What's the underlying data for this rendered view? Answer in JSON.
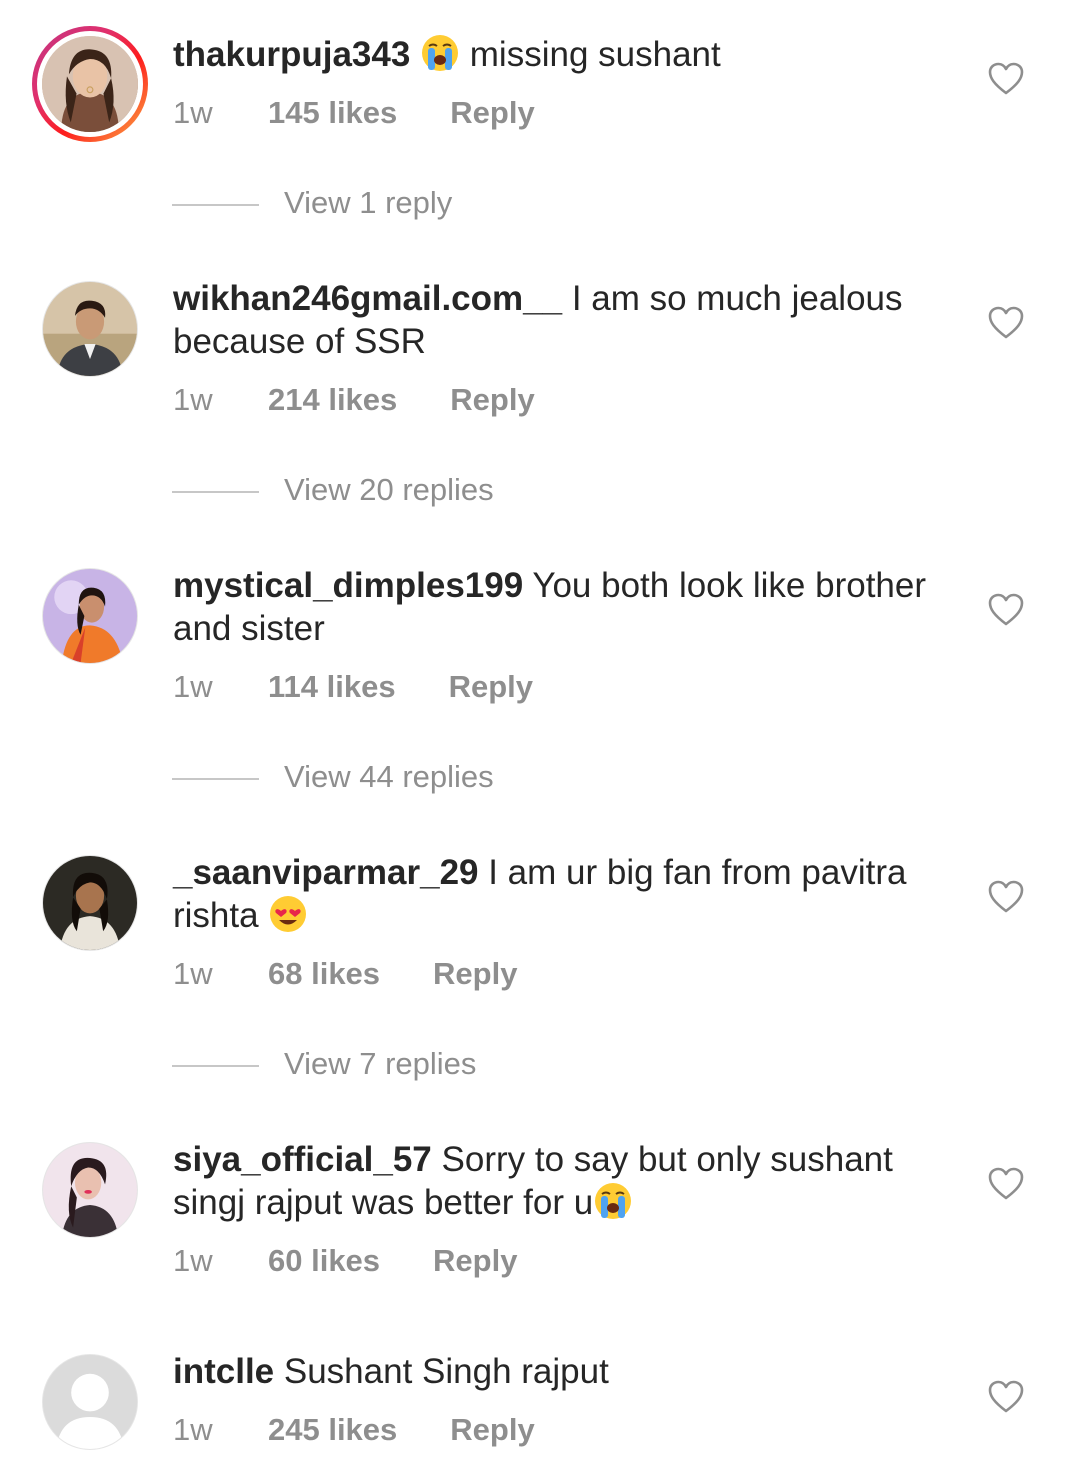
{
  "comments": [
    {
      "username": "thakurpuja343",
      "text_before": "",
      "text_after": "missing sushant",
      "emoji_position": "before",
      "emoji": "loudly-crying-face",
      "time": "1w",
      "likes": "145 likes",
      "reply_label": "Reply",
      "view_replies": "View 1 reply",
      "avatar": "woman-photo",
      "has_story_ring": true
    },
    {
      "username": "wikhan246gmail.com__",
      "text": "I am so much jealous because of SSR",
      "time": "1w",
      "likes": "214 likes",
      "reply_label": "Reply",
      "view_replies": "View 20 replies",
      "avatar": "man-in-suit-photo"
    },
    {
      "username": "mystical_dimples199",
      "text": "You both look like brother and sister",
      "time": "1w",
      "likes": "114 likes",
      "reply_label": "Reply",
      "view_replies": "View 44 replies",
      "avatar": "woman-orange-dress-photo"
    },
    {
      "username": "_saanviparmar_29",
      "text": "I am ur big fan from pavitra rishta",
      "emoji": "heart-eyes-face",
      "time": "1w",
      "likes": "68 likes",
      "reply_label": "Reply",
      "view_replies": "View 7 replies",
      "avatar": "woman-dark-background-photo"
    },
    {
      "username": "siya_official_57",
      "text": "Sorry to say but only sushant singj rajput was better for u",
      "emoji": "loudly-crying-face",
      "time": "1w",
      "likes": "60 likes",
      "reply_label": "Reply",
      "avatar": "woman-pink-photo"
    },
    {
      "username": "intclle",
      "text": "Sushant Singh rajput",
      "time": "1w",
      "likes": "245 likes",
      "reply_label": "Reply",
      "avatar": "default-avatar"
    }
  ],
  "colors": {
    "primary_text": "#262626",
    "secondary_text": "#8e8e8e",
    "divider": "#c7c7c7",
    "story_ring": [
      "#c13584",
      "#e1306c",
      "#fd1d1d",
      "#fcaf45"
    ]
  },
  "icons": {
    "like": "heart-outline-icon"
  }
}
